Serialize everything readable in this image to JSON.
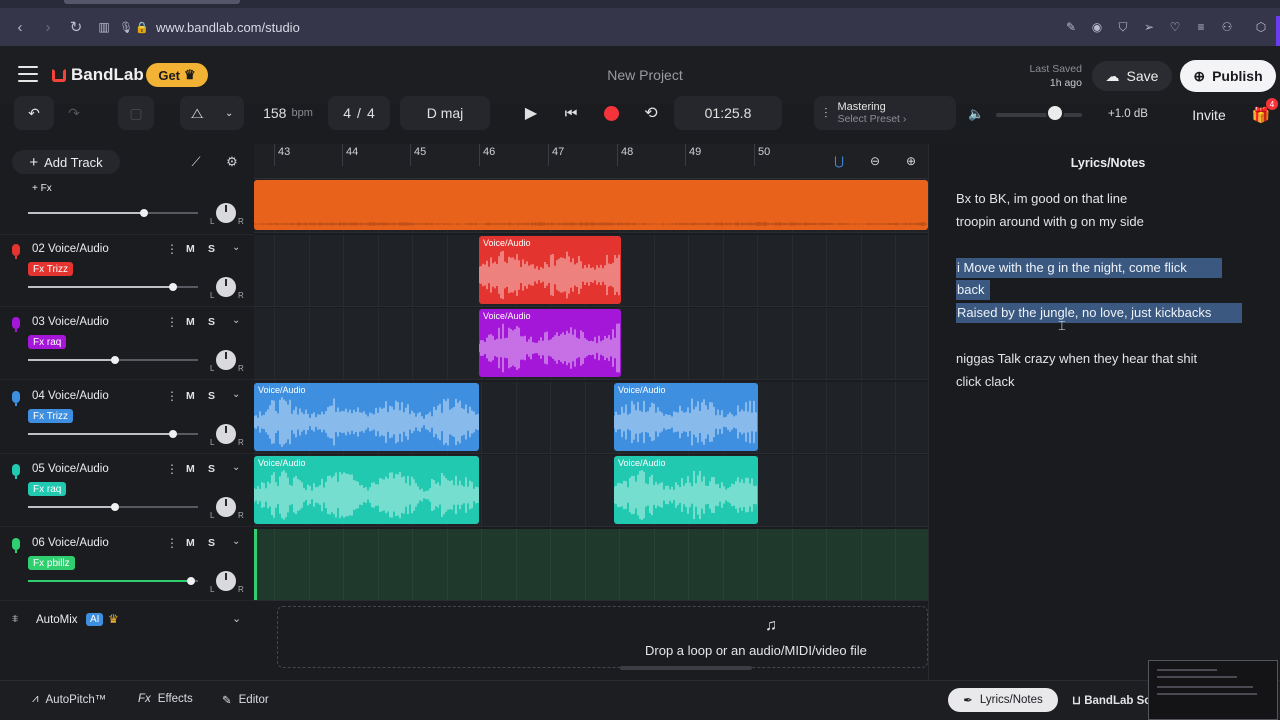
{
  "browser": {
    "url": "www.bandlab.com/studio"
  },
  "header": {
    "logo_text": "BandLab",
    "get_label": "Get",
    "project_title": "New Project",
    "last_saved_label": "Last Saved",
    "last_saved_value": "1h ago",
    "save_label": "Save",
    "publish_label": "Publish"
  },
  "transport": {
    "bpm": "158",
    "bpm_unit": "bpm",
    "time_sig_num": "4",
    "time_sig_sep": "/",
    "time_sig_den": "4",
    "key": "D maj",
    "time": "01:25.8",
    "mastering_title": "Mastering",
    "mastering_sub": "Select Preset",
    "volume_db": "+1.0 dB",
    "volume_level": 0.7,
    "invite_label": "Invite",
    "gift_badge": "4"
  },
  "tracks_toolbar": {
    "add_track_label": "Add Track"
  },
  "ruler": {
    "bars": [
      "43",
      "44",
      "45",
      "46",
      "47",
      "48",
      "49",
      "50"
    ]
  },
  "tracks": [
    {
      "id": "01",
      "name": "",
      "fx": "+ Fx",
      "color": "#e8621c",
      "volume": 0.68
    },
    {
      "id": "02",
      "name": "02  Voice/Audio",
      "fx": "Fx Trizz",
      "color": "#e3342f",
      "volume": 0.85
    },
    {
      "id": "03",
      "name": "03  Voice/Audio",
      "fx": "Fx raq",
      "color": "#a517d8",
      "volume": 0.51
    },
    {
      "id": "04",
      "name": "04  Voice/Audio",
      "fx": "Fx Trizz",
      "color": "#3f8fe0",
      "volume": 0.85
    },
    {
      "id": "05",
      "name": "05  Voice/Audio",
      "fx": "Fx raq",
      "color": "#21c9b0",
      "volume": 0.51
    },
    {
      "id": "06",
      "name": "06  Voice/Audio",
      "fx": "Fx pbillz",
      "color": "#2fcf6f",
      "volume": 0.96
    }
  ],
  "track_controls": {
    "mute": "M",
    "solo": "S",
    "left": "L",
    "right": "R"
  },
  "clips": {
    "label": "Voice/Audio"
  },
  "automix": {
    "label": "AutoMix",
    "ai_badge": "AI"
  },
  "drop_zone": {
    "text": "Drop a loop or an audio/MIDI/video file"
  },
  "lyrics": {
    "title": "Lyrics/Notes",
    "lines": [
      "Bx to BK, im good on that line",
      "troopin around with g on my side",
      "i Move with the g in the night, come flick",
      "back",
      "Raised by the jungle, no love, just kickbacks",
      "niggas Talk crazy when they hear that shit",
      "click clack"
    ]
  },
  "bottom_bar": {
    "autopitch": "AutoPitch™",
    "effects": "Effects",
    "editor": "Editor",
    "lyrics_notes": "Lyrics/Notes",
    "bandlab_sounds": "BandLab Sounds"
  },
  "icons": {
    "back": "chevron-left-icon",
    "forward": "chevron-right-icon",
    "reload": "reload-icon",
    "lock": "lock-icon",
    "mic": "mic-icon"
  }
}
